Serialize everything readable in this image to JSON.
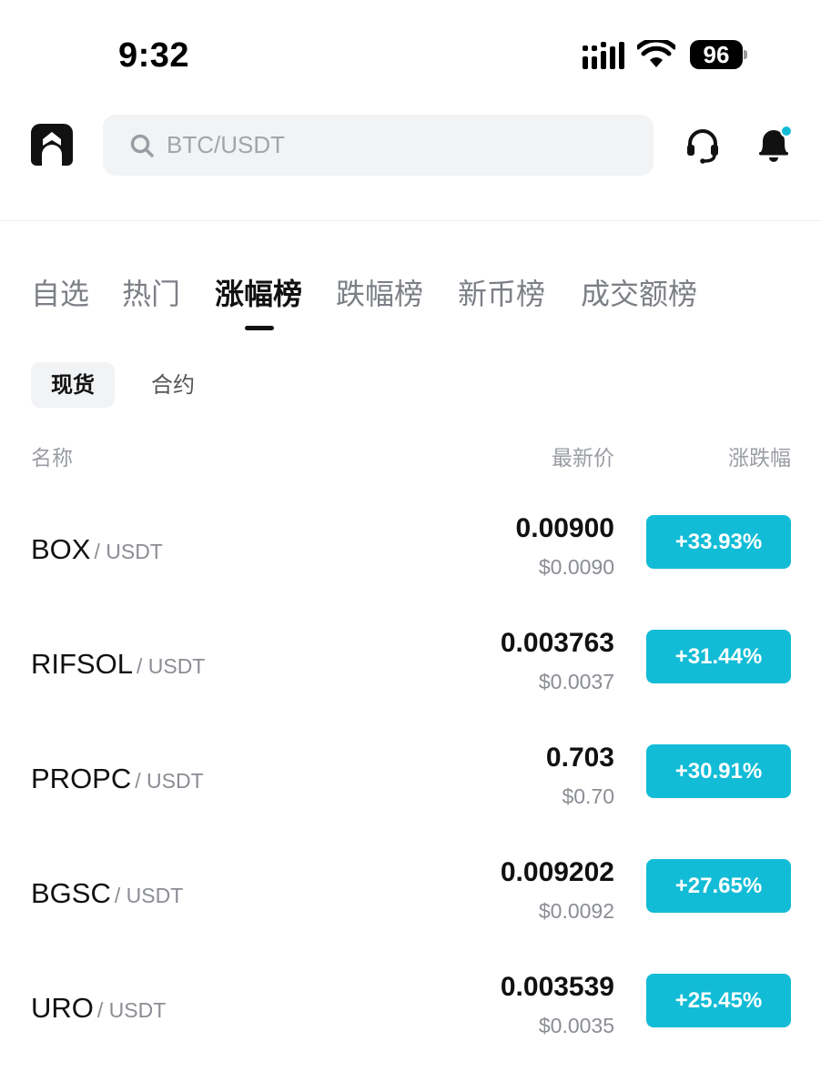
{
  "status_bar": {
    "time": "9:32",
    "battery": "96"
  },
  "header": {
    "search_placeholder": "BTC/USDT",
    "icons": {
      "logo": "app-logo-icon",
      "search": "search-icon",
      "support": "headset-icon",
      "notifications": "bell-icon"
    },
    "notification_dot_color": "#12bcd6"
  },
  "tabs": [
    {
      "label": "自选",
      "active": false
    },
    {
      "label": "热门",
      "active": false
    },
    {
      "label": "涨幅榜",
      "active": true
    },
    {
      "label": "跌幅榜",
      "active": false
    },
    {
      "label": "新币榜",
      "active": false
    },
    {
      "label": "成交额榜",
      "active": false
    }
  ],
  "subtabs": [
    {
      "label": "现货",
      "active": true
    },
    {
      "label": "合约",
      "active": false
    }
  ],
  "columns": {
    "name": "名称",
    "price": "最新价",
    "change": "涨跌幅"
  },
  "rows": [
    {
      "base": "BOX",
      "quote": "/ USDT",
      "price": "0.00900",
      "fiat": "$0.0090",
      "change": "+33.93%"
    },
    {
      "base": "RIFSOL",
      "quote": "/ USDT",
      "price": "0.003763",
      "fiat": "$0.0037",
      "change": "+31.44%"
    },
    {
      "base": "PROPC",
      "quote": "/ USDT",
      "price": "0.703",
      "fiat": "$0.70",
      "change": "+30.91%"
    },
    {
      "base": "BGSC",
      "quote": "/ USDT",
      "price": "0.009202",
      "fiat": "$0.0092",
      "change": "+27.65%"
    },
    {
      "base": "URO",
      "quote": "/ USDT",
      "price": "0.003539",
      "fiat": "$0.0035",
      "change": "+25.45%"
    }
  ],
  "colors": {
    "up_badge": "#12bcd6",
    "text_primary": "#111111",
    "text_secondary": "#8a8d93"
  }
}
